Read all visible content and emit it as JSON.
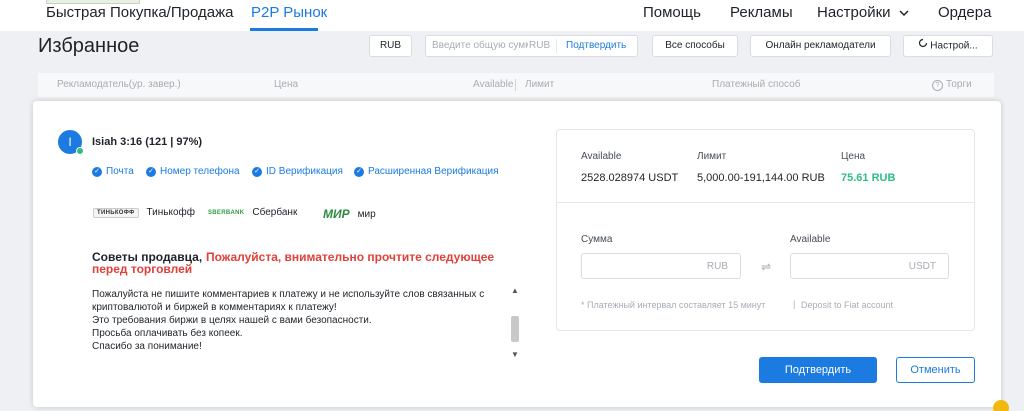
{
  "nav": {
    "items": [
      "Быстрая Покупка/Продажа",
      "P2P Рынок",
      "Помощь",
      "Рекламы",
      "Настройки",
      "Ордера"
    ],
    "active_index": 1
  },
  "header": {
    "title": "Избранное",
    "currency_button": "RUB",
    "amount_placeholder": "Введите общую сумму",
    "amount_currency": "RUB",
    "amount_confirm": "Подтвердить",
    "all_methods_button": "Все способы",
    "online_ads_button": "Онлайн рекламодатели",
    "refresh_button": "Настрой..."
  },
  "table_header": {
    "advertiser": "Рекламодатель(ур. завер.)",
    "price": "Цена",
    "available": "Available",
    "limit": "Лимит",
    "payment": "Платежный способ",
    "trade": "Торги"
  },
  "seller": {
    "avatar_letter": "I",
    "name": "Isiah 3:16 (121 | 97%)",
    "verifications": [
      "Почта",
      "Номер телефона",
      "ID Верификация",
      "Расширенная Верификация"
    ],
    "payment_methods": [
      {
        "logo": "ТИНЬКОФФ",
        "label": "Тинькофф"
      },
      {
        "logo": "SBERBANK",
        "label": "Сбербанк"
      },
      {
        "logo": "МИР",
        "label": "мир"
      }
    ]
  },
  "tips": {
    "title": "Советы продавца",
    "warning_line1": "Пожалуйста, внимательно прочтите следующее",
    "warning_line2": "перед торговлей",
    "lines": [
      "Пожалуйста не пишите комментариев к платежу и не используйте слов связанных с",
      "криптовалютой и биржей в комментариях к платежу!",
      "Это требования биржи в целях нашей с вами безопасности.",
      "Просьба оплачивать без копеек.",
      "Спасибо за понимание!"
    ]
  },
  "order": {
    "available_label": "Available",
    "available_value": "2528.028974 USDT",
    "limit_label": "Лимит",
    "limit_value": "5,000.00-191,144.00 RUB",
    "price_label": "Цена",
    "price_value": "75.61 RUB",
    "sum_label": "Сумма",
    "sum_suffix": "RUB",
    "receive_label": "Available",
    "receive_suffix": "USDT",
    "note": "* Платежный интервал составляет 15 минут",
    "deposit_link": "Deposit to Fiat account",
    "confirm_button": "Подтвердить",
    "cancel_button": "Отменить"
  },
  "colors": {
    "accent": "#1c7be0",
    "price_green": "#2ebd85",
    "warning_red": "#e0403a"
  }
}
